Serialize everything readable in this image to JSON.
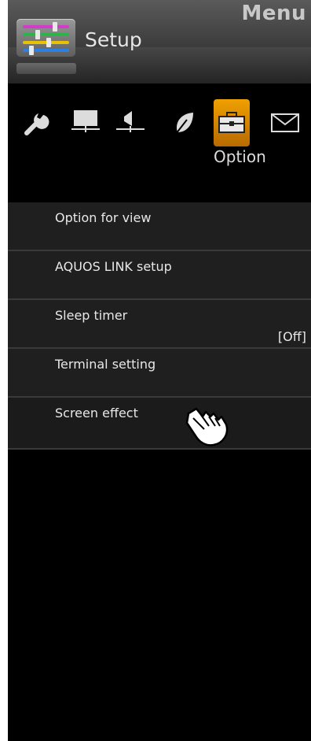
{
  "header": {
    "menu_label": "Menu",
    "section_title": "Setup"
  },
  "category": {
    "selected_label": "Option"
  },
  "category_icons": [
    "wrench-icon",
    "monitor-icon",
    "speaker-icon",
    "leaf-icon",
    "toolbox-icon",
    "envelope-icon"
  ],
  "items": [
    {
      "label": "Option for view",
      "value": ""
    },
    {
      "label": "AQUOS LINK setup",
      "value": ""
    },
    {
      "label": "Sleep timer",
      "value": "[Off]"
    },
    {
      "label": "Terminal setting",
      "value": ""
    },
    {
      "label": "Screen effect",
      "value": ""
    }
  ],
  "colors": {
    "selected_tab": "#e89a00",
    "background": "#000000",
    "item_bg": "#1f1f1f"
  }
}
